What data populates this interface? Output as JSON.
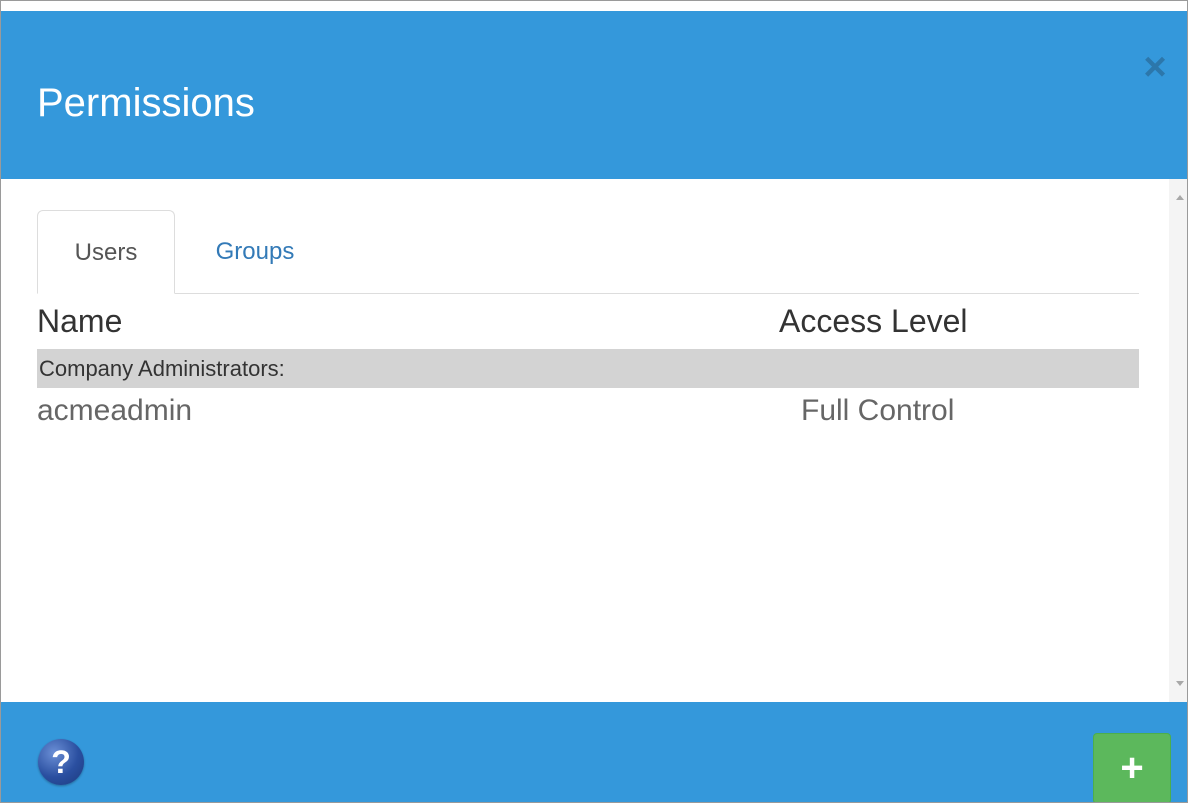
{
  "dialog": {
    "title": "Permissions",
    "close_icon": "×"
  },
  "tabs": [
    {
      "label": "Users",
      "active": true
    },
    {
      "label": "Groups",
      "active": false
    }
  ],
  "table": {
    "columns": {
      "name": "Name",
      "access": "Access Level"
    },
    "groups": [
      {
        "label": "Company Administrators:",
        "rows": [
          {
            "name": "acmeadmin",
            "access": "Full Control"
          }
        ]
      }
    ]
  },
  "footer": {
    "help_icon": "?",
    "add_icon": "+"
  },
  "colors": {
    "header_bg": "#3498db",
    "footer_bg": "#3498db",
    "add_button": "#5cb85c",
    "tab_link": "#337ab7",
    "group_row_bg": "#d3d3d3"
  }
}
